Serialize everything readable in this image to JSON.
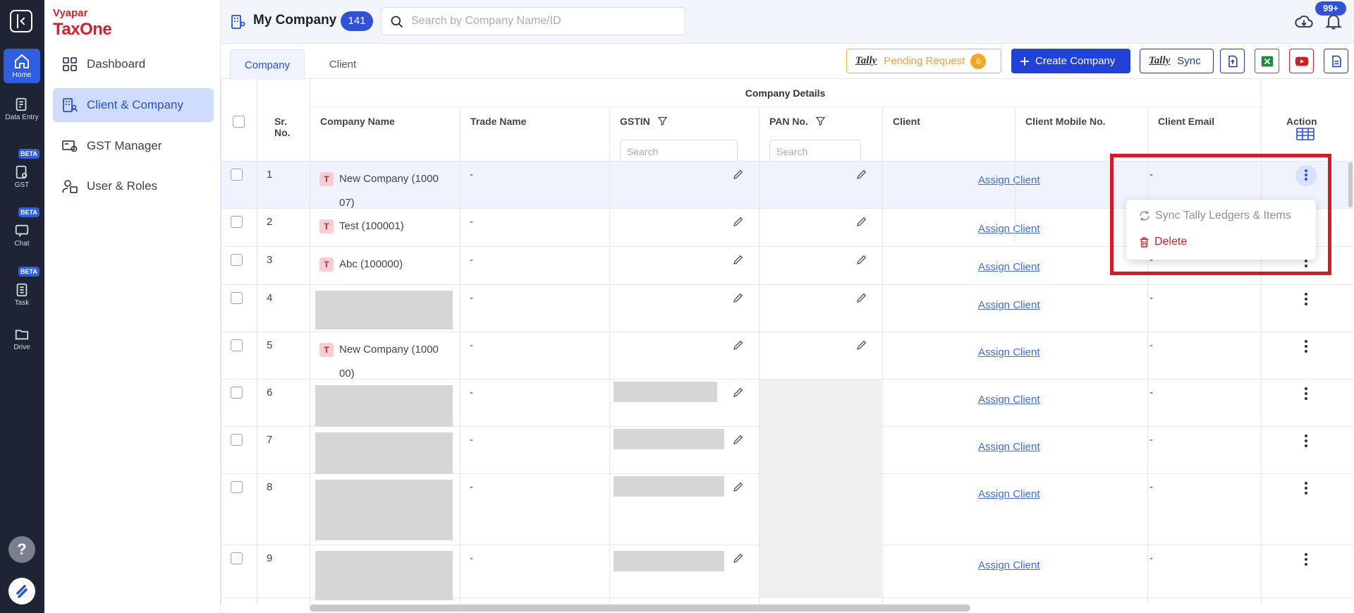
{
  "rail": {
    "items": [
      {
        "label": "Home",
        "icon": "home-icon",
        "active": true
      },
      {
        "label": "Data Entry",
        "icon": "data-entry-icon"
      },
      {
        "label": "GST",
        "icon": "gst-icon",
        "badge": "BETA"
      },
      {
        "label": "Chat",
        "icon": "chat-icon",
        "badge": "BETA"
      },
      {
        "label": "Task",
        "icon": "task-icon",
        "badge": "BETA"
      },
      {
        "label": "Drive",
        "icon": "drive-icon"
      }
    ],
    "help": "?"
  },
  "brand": {
    "line1": "Vyapar",
    "line2": "TaxOne"
  },
  "sidebar": {
    "items": [
      {
        "label": "Dashboard",
        "icon": "dashboard-icon"
      },
      {
        "label": "Client & Company",
        "icon": "client-company-icon",
        "active": true
      },
      {
        "label": "GST Manager",
        "icon": "gst-manager-icon"
      },
      {
        "label": "User & Roles",
        "icon": "user-roles-icon"
      }
    ]
  },
  "header": {
    "title": "My Company",
    "count": "141",
    "search_placeholder": "Search by Company Name/ID",
    "notification_badge": "99+"
  },
  "tabs": [
    {
      "label": "Company",
      "active": true
    },
    {
      "label": "Client"
    }
  ],
  "toolbar": {
    "tally_logo": "Tally",
    "pending_label": "Pending Request",
    "pending_count": "6",
    "create_label": "Create Company",
    "sync_label": "Sync"
  },
  "table": {
    "group_header": "Company Details",
    "columns": {
      "sr": "Sr. No.",
      "company": "Company Name",
      "trade": "Trade Name",
      "gstin": "GSTIN",
      "pan": "PAN No.",
      "client": "Client",
      "mobile": "Client Mobile No.",
      "email": "Client Email",
      "action": "Action"
    },
    "filter_placeholder": "Search",
    "assign_label": "Assign Client",
    "rows": [
      {
        "sr": "1",
        "badge": "T",
        "name_l1": "New Company (1000",
        "name_l2": "07)",
        "trade": "-",
        "email": "-"
      },
      {
        "sr": "2",
        "badge": "T",
        "name_l1": "Test (100001)",
        "name_l2": "",
        "trade": "-",
        "email": "-"
      },
      {
        "sr": "3",
        "badge": "T",
        "name_l1": "Abc (100000)",
        "name_l2": "",
        "trade": "-",
        "email": "-"
      },
      {
        "sr": "4",
        "badge": "",
        "name_l1": "",
        "name_l2": "",
        "trade": "-",
        "email": "-"
      },
      {
        "sr": "5",
        "badge": "T",
        "name_l1": "New Company (1000",
        "name_l2": "00)",
        "trade": "-",
        "email": "-"
      },
      {
        "sr": "6",
        "badge": "",
        "name_l1": "",
        "name_l2": "",
        "trade": "-",
        "email": "-"
      },
      {
        "sr": "7",
        "badge": "",
        "name_l1": "",
        "name_l2": "",
        "trade": "-",
        "email": "-"
      },
      {
        "sr": "8",
        "badge": "",
        "name_l1": "",
        "name_l2": "",
        "trade": "-",
        "email": "-"
      },
      {
        "sr": "9",
        "badge": "",
        "name_l1": "",
        "name_l2": "",
        "trade": "-",
        "email": "-"
      }
    ]
  },
  "action_menu": {
    "sync_label": "Sync Tally Ledgers & Items",
    "delete_label": "Delete"
  },
  "colors": {
    "accent": "#2f52d6",
    "brand_red": "#d4202c",
    "highlight": "#d41c24"
  }
}
